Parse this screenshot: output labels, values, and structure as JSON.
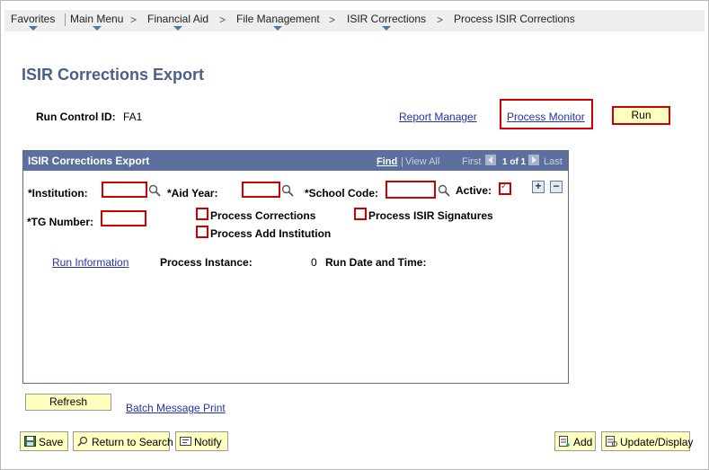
{
  "breadcrumb": [
    "Favorites",
    "Main Menu",
    "Financial Aid",
    "File Management",
    "ISIR Corrections",
    "Process ISIR Corrections"
  ],
  "separator": ">",
  "page_title": "ISIR Corrections Export",
  "run_control": {
    "label": "Run Control ID:",
    "value": "FA1"
  },
  "links": {
    "report_manager": "Report Manager",
    "process_monitor": "Process Monitor"
  },
  "run_button": "Run",
  "grid": {
    "title": "ISIR Corrections Export",
    "find": "Find",
    "pipe": "|",
    "view_all": "View All",
    "first": "First",
    "count": "1 of 1",
    "last": "Last",
    "plus": "+",
    "minus": "−"
  },
  "fields": {
    "institution": {
      "label": "*Institution:",
      "value": ""
    },
    "aid_year": {
      "label": "*Aid Year:",
      "value": ""
    },
    "school_code": {
      "label": "*School Code:",
      "value": ""
    },
    "active": {
      "label": "Active:",
      "checked": true
    },
    "tg_number": {
      "label": "*TG Number:",
      "value": ""
    }
  },
  "checkboxes": {
    "process_corrections": "Process Corrections",
    "process_isir_signatures": "Process ISIR Signatures",
    "process_add_institution": "Process Add Institution"
  },
  "run_info": {
    "link": "Run Information",
    "process_instance_label": "Process Instance:",
    "process_instance_value": "0",
    "run_date_label": "Run Date and Time:"
  },
  "refresh_button": "Refresh",
  "batch_message_print": "Batch Message Print",
  "toolbar": {
    "save": "Save",
    "return_to_search": "Return to Search",
    "notify": "Notify",
    "add": "Add",
    "update_display": "Update/Display"
  },
  "colors": {
    "title": "#4a5f8a",
    "grid_header": "#5d6f9c",
    "required_border": "#cc0000",
    "button_bg": "#ffffc0",
    "link": "#2433a8"
  }
}
